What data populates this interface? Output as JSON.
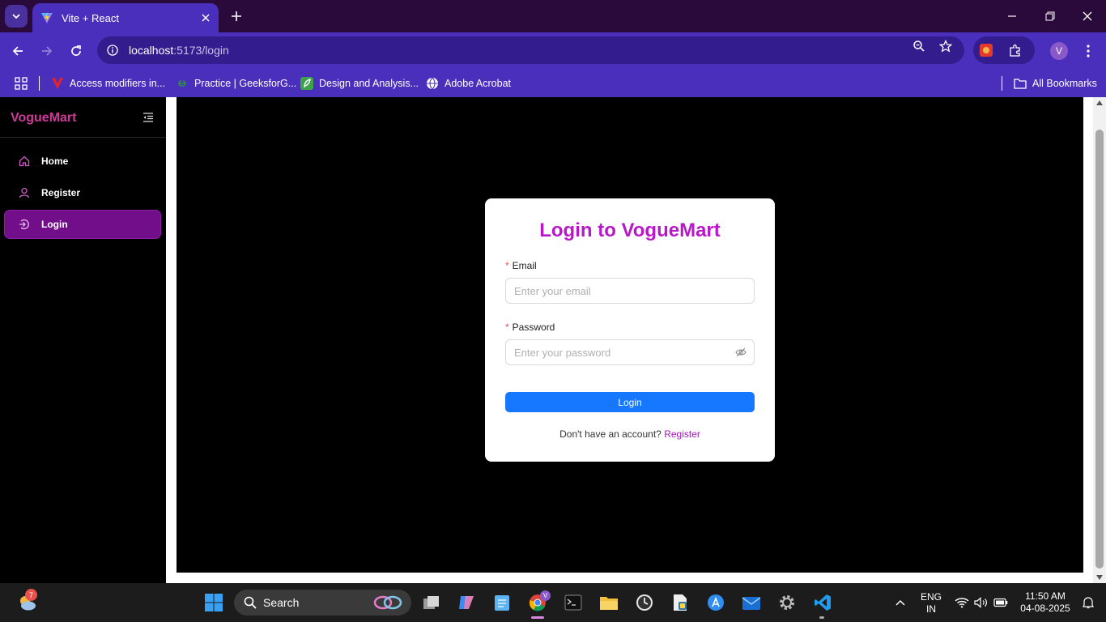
{
  "browser": {
    "tab_title": "Vite + React",
    "url_host": "localhost",
    "url_path": ":5173/login",
    "profile_initial": "V",
    "bookmarks": [
      {
        "label": "Access modifiers in...",
        "icon": "youtube-like-icon"
      },
      {
        "label": "Practice | GeeksforG...",
        "icon": "geeksforgeeks-icon"
      },
      {
        "label": "Design and Analysis...",
        "icon": "green-leaf-icon"
      },
      {
        "label": "Adobe Acrobat",
        "icon": "globe-icon"
      }
    ],
    "all_bookmarks_label": "All Bookmarks"
  },
  "app": {
    "brand": "VogueMart",
    "nav": [
      {
        "label": "Home",
        "icon": "home-icon",
        "active": false
      },
      {
        "label": "Register",
        "icon": "user-icon",
        "active": false
      },
      {
        "label": "Login",
        "icon": "login-icon",
        "active": true
      }
    ]
  },
  "login": {
    "title": "Login to VogueMart",
    "email_label": "Email",
    "email_placeholder": "Enter your email",
    "email_value": "",
    "password_label": "Password",
    "password_placeholder": "Enter your password",
    "password_value": "",
    "submit_label": "Login",
    "signup_prompt": "Don't have an account?",
    "signup_link": "Register",
    "required_mark": "*"
  },
  "taskbar": {
    "search_label": "Search",
    "weather_badge": "7",
    "lang_line1": "ENG",
    "lang_line2": "IN",
    "time": "11:50 AM",
    "date": "04-08-2025",
    "chrome_badge": "V"
  },
  "colors": {
    "brand_accent": "#b818c8",
    "primary_button": "#1677ff",
    "nav_active_bg": "#720e8a",
    "chrome_frame": "#4a2fbd"
  }
}
